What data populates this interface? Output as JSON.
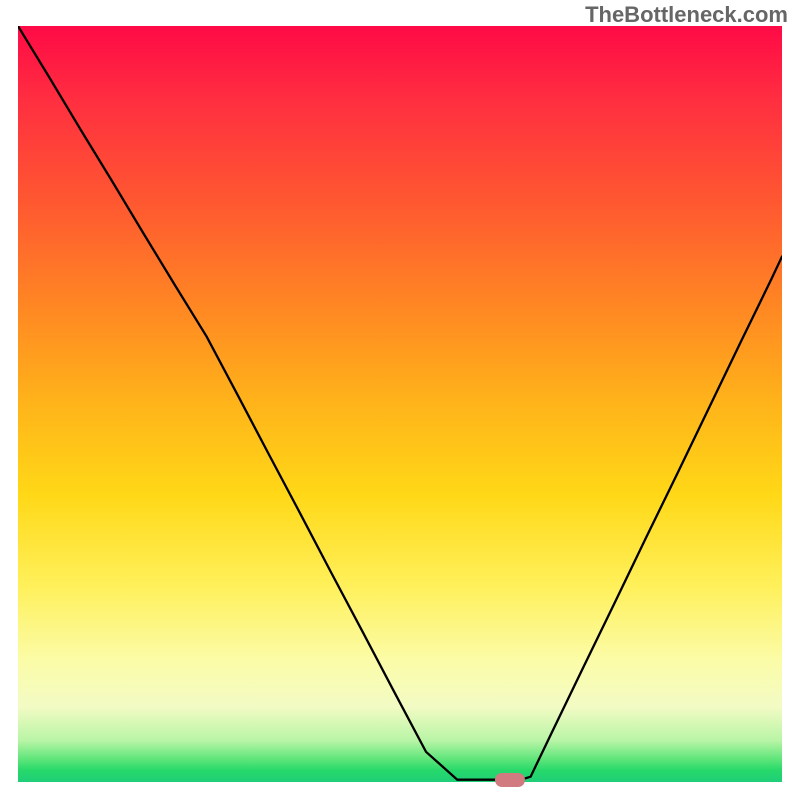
{
  "watermark": "TheBottleneck.com",
  "chart_data": {
    "type": "line",
    "title": "",
    "xlabel": "",
    "ylabel": "",
    "x": [
      0.0,
      0.041,
      0.082,
      0.123,
      0.164,
      0.205,
      0.247,
      0.288,
      0.329,
      0.37,
      0.411,
      0.452,
      0.493,
      0.534,
      0.575,
      0.616,
      0.63,
      0.658,
      0.671,
      0.699,
      0.74,
      0.781,
      0.822,
      0.863,
      0.904,
      0.945,
      0.986,
      1.0
    ],
    "y": [
      1.0,
      0.932,
      0.863,
      0.795,
      0.726,
      0.658,
      0.589,
      0.511,
      0.432,
      0.354,
      0.275,
      0.197,
      0.118,
      0.04,
      0.003,
      0.003,
      0.003,
      0.003,
      0.007,
      0.066,
      0.152,
      0.237,
      0.323,
      0.408,
      0.494,
      0.58,
      0.665,
      0.695
    ],
    "xlim": [
      0,
      1
    ],
    "ylim": [
      0,
      1
    ],
    "grid": false,
    "legend": false,
    "marker": {
      "x": 0.644,
      "y": 0.003,
      "style": "capsule",
      "color": "#d17a7f"
    },
    "background": "red_to_green_vertical_gradient"
  }
}
